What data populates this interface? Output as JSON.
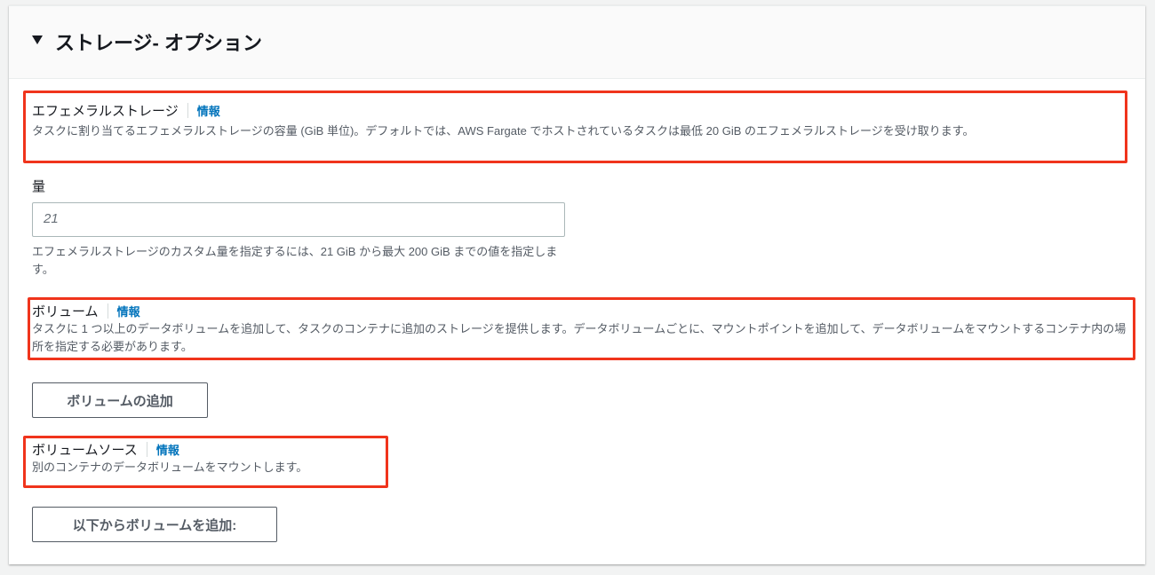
{
  "section": {
    "title": "ストレージ- オプション"
  },
  "ephemeral": {
    "label": "エフェメラルストレージ",
    "info": "情報",
    "description": "タスクに割り当てるエフェメラルストレージの容量 (GiB 単位)。デフォルトでは、AWS Fargate でホストされているタスクは最低 20 GiB のエフェメラルストレージを受け取ります。"
  },
  "amount": {
    "label": "量",
    "value": "21",
    "hint": "エフェメラルストレージのカスタム量を指定するには、21 GiB から最大 200 GiB までの値を指定します。"
  },
  "volume": {
    "label": "ボリューム",
    "info": "情報",
    "description": "タスクに 1 つ以上のデータボリュームを追加して、タスクのコンテナに追加のストレージを提供します。データボリュームごとに、マウントポイントを追加して、データボリュームをマウントするコンテナ内の場所を指定する必要があります。",
    "add_button": "ボリュームの追加"
  },
  "volume_source": {
    "label": "ボリュームソース",
    "info": "情報",
    "description": "別のコンテナのデータボリュームをマウントします。",
    "add_button": "以下からボリュームを追加:"
  }
}
